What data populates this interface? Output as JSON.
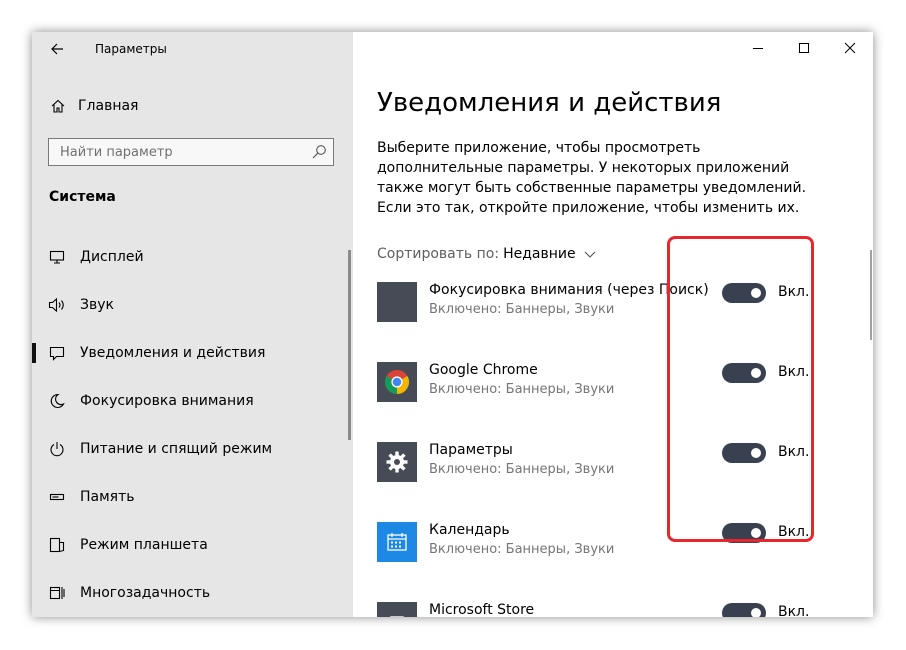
{
  "window": {
    "title": "Параметры"
  },
  "sidebar": {
    "home_label": "Главная",
    "search_placeholder": "Найти параметр",
    "section_title": "Система",
    "items": [
      {
        "label": "Дисплей",
        "icon": "monitor-icon",
        "active": false
      },
      {
        "label": "Звук",
        "icon": "speaker-icon",
        "active": false
      },
      {
        "label": "Уведомления и действия",
        "icon": "notification-icon",
        "active": true
      },
      {
        "label": "Фокусировка внимания",
        "icon": "moon-icon",
        "active": false
      },
      {
        "label": "Питание и спящий режим",
        "icon": "power-icon",
        "active": false
      },
      {
        "label": "Память",
        "icon": "storage-icon",
        "active": false
      },
      {
        "label": "Режим планшета",
        "icon": "tablet-icon",
        "active": false
      },
      {
        "label": "Многозадачность",
        "icon": "multitask-icon",
        "active": false
      }
    ]
  },
  "main": {
    "title": "Уведомления и действия",
    "description": "Выберите приложение, чтобы просмотреть дополнительные параметры. У некоторых приложений также могут быть собственные параметры уведомлений. Если это так, откройте приложение, чтобы изменить их.",
    "sort_label": "Сортировать по:",
    "sort_value": "Недавние",
    "apps": [
      {
        "name": "Фокусировка внимания (через Поиск)",
        "status": "Включено: Баннеры, Звуки",
        "toggle": "Вкл.",
        "icon": "focus-assist-app-icon",
        "on": true
      },
      {
        "name": "Google Chrome",
        "status": "Включено: Баннеры, Звуки",
        "toggle": "Вкл.",
        "icon": "chrome-icon",
        "on": true
      },
      {
        "name": "Параметры",
        "status": "Включено: Баннеры, Звуки",
        "toggle": "Вкл.",
        "icon": "settings-gear-icon",
        "on": true
      },
      {
        "name": "Календарь",
        "status": "Включено: Баннеры, Звуки",
        "toggle": "Вкл.",
        "icon": "calendar-icon",
        "on": true
      },
      {
        "name": "Microsoft Store",
        "status": "",
        "toggle": "Вкл.",
        "icon": "store-icon",
        "on": true
      }
    ]
  },
  "colors": {
    "sidebar_bg": "#e6e6e6",
    "toggle_on": "#394050",
    "highlight": "#e8262e",
    "calendar_blue": "#1e88e5",
    "app_tile_dark": "#474b55"
  }
}
